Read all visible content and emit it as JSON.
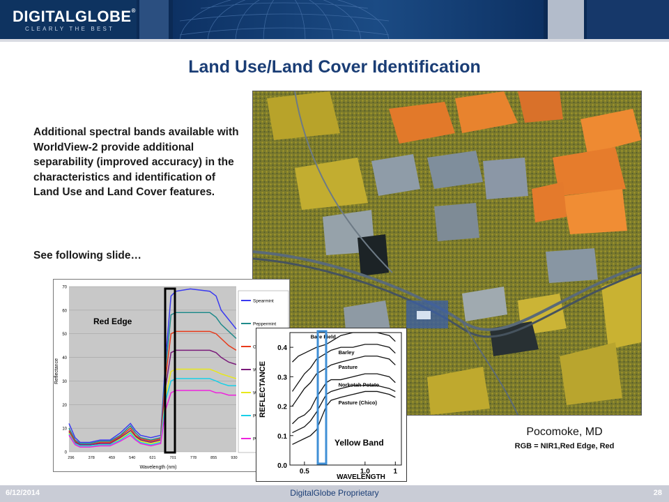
{
  "header": {
    "logo_text": "DIGITALGLOBE",
    "logo_mark": "®",
    "tagline": "CLEARLY THE BEST",
    "colors": {
      "navy": "#0b2a55",
      "tile_light": "#b3bccb",
      "tile_mid": "#7d8ea8"
    }
  },
  "slide": {
    "title": "Land Use/Land Cover Identification",
    "body": "Additional spectral bands available with WorldView-2 provide additional separability (improved accuracy) in the characteristics and identification of Land Use and Land Cover features.",
    "follow_up": "See following slide…"
  },
  "caption": {
    "place": "Pocomoke, MD",
    "rgb": "RGB = NIR1,Red Edge, Red"
  },
  "footer": {
    "date": "6/12/2014",
    "center": "DigitalGlobe Proprietary",
    "page": "28"
  },
  "chart_data": [
    {
      "type": "line",
      "title": "",
      "xlabel": "Wavelength (nm)",
      "ylabel": "Reflectance",
      "annotation": "Red Edge",
      "x_ticks": [
        "296",
        "378",
        "459",
        "540",
        "621",
        "701",
        "778",
        "855",
        "930"
      ],
      "y_ticks": [
        0,
        10,
        20,
        30,
        40,
        50,
        60,
        70
      ],
      "ylim": [
        0,
        70
      ],
      "legend_position": "right",
      "x": [
        296,
        320,
        340,
        378,
        420,
        459,
        500,
        540,
        560,
        580,
        621,
        660,
        680,
        701,
        720,
        778,
        855,
        880,
        900,
        930,
        960
      ],
      "series": [
        {
          "name": "Spearmint",
          "color": "#3a3af0",
          "values": [
            12,
            6,
            4,
            4,
            5,
            5,
            8,
            12,
            9,
            7,
            6,
            7,
            40,
            66,
            68,
            69,
            68,
            66,
            60,
            56,
            52
          ]
        },
        {
          "name": "Peppermint",
          "color": "#1f8a8a",
          "values": [
            10,
            5,
            3.5,
            3.5,
            4.5,
            4.5,
            7,
            11,
            8,
            6,
            5,
            6,
            36,
            58,
            59,
            59,
            59,
            57,
            54,
            51,
            48
          ]
        },
        {
          "name": "Gl",
          "color": "#e83a1a",
          "values": [
            9,
            4.5,
            3,
            3,
            4,
            4,
            6.5,
            10,
            7,
            5.5,
            4.5,
            5.5,
            32,
            50,
            51,
            51,
            51,
            50,
            48,
            45,
            43
          ]
        },
        {
          "name": "W",
          "color": "#7a1a7a",
          "values": [
            8.5,
            4,
            3,
            3,
            3.5,
            3.5,
            6,
            9,
            6.5,
            5,
            4,
            5,
            28,
            42,
            43,
            43,
            43,
            42,
            40,
            38,
            37
          ]
        },
        {
          "name": "W",
          "color": "#e8e81a",
          "values": [
            8,
            3.5,
            2.5,
            2.5,
            3,
            3,
            5.5,
            8.5,
            6,
            4.5,
            3.5,
            4.5,
            24,
            34,
            35,
            35,
            35,
            34,
            33,
            32,
            31
          ]
        },
        {
          "name": "P",
          "color": "#18d0e8",
          "values": [
            7.5,
            3.5,
            2.5,
            2.5,
            3,
            3,
            5,
            8,
            5.5,
            4,
            3,
            4,
            22,
            30,
            31,
            31,
            31,
            30,
            29,
            28,
            28
          ]
        },
        {
          "name": "P",
          "color": "#ee22dd",
          "values": [
            7,
            3,
            2,
            2,
            2.5,
            2.5,
            4.5,
            7,
            5,
            3.5,
            2.5,
            3.5,
            18,
            25,
            26,
            26,
            26,
            25,
            25,
            24,
            24
          ]
        }
      ]
    },
    {
      "type": "line",
      "title": "",
      "xlabel": "WAVELENGTH",
      "ylabel": "REFLECTANCE",
      "annotation": "Yellow Band",
      "x_ticks": [
        "0.5",
        "1.0",
        "1"
      ],
      "x_tick_values": [
        0.5,
        1.0,
        1.25
      ],
      "y_ticks": [
        "0.0",
        "0.1",
        "0.2",
        "0.3",
        "0.4"
      ],
      "ylim": [
        0,
        0.45
      ],
      "xlim": [
        0.38,
        1.3
      ],
      "x": [
        0.4,
        0.45,
        0.5,
        0.55,
        0.6,
        0.68,
        0.72,
        0.8,
        0.9,
        1.0,
        1.1,
        1.2,
        1.25
      ],
      "series": [
        {
          "name": "Bare Field",
          "color": "#111111",
          "values": [
            0.35,
            0.37,
            0.38,
            0.39,
            0.4,
            0.41,
            0.42,
            0.44,
            0.45,
            0.45,
            0.45,
            0.44,
            0.42
          ]
        },
        {
          "name": "Barley",
          "color": "#111111",
          "values": [
            0.25,
            0.28,
            0.31,
            0.33,
            0.36,
            0.38,
            0.39,
            0.4,
            0.4,
            0.41,
            0.41,
            0.4,
            0.38
          ]
        },
        {
          "name": "Pasture",
          "color": "#111111",
          "values": [
            0.2,
            0.23,
            0.26,
            0.28,
            0.31,
            0.33,
            0.34,
            0.35,
            0.36,
            0.37,
            0.37,
            0.36,
            0.34
          ]
        },
        {
          "name": "Norkotah Potato",
          "color": "#111111",
          "values": [
            0.14,
            0.16,
            0.17,
            0.19,
            0.23,
            0.28,
            0.29,
            0.29,
            0.3,
            0.31,
            0.31,
            0.3,
            0.28
          ]
        },
        {
          "name": "",
          "color": "#111111",
          "values": [
            0.11,
            0.12,
            0.13,
            0.15,
            0.18,
            0.24,
            0.25,
            0.26,
            0.27,
            0.27,
            0.27,
            0.26,
            0.25
          ]
        },
        {
          "name": "Pasture (Chico)",
          "color": "#111111",
          "values": [
            0.07,
            0.08,
            0.09,
            0.1,
            0.12,
            0.2,
            0.22,
            0.23,
            0.24,
            0.25,
            0.25,
            0.24,
            0.23
          ]
        }
      ]
    }
  ]
}
